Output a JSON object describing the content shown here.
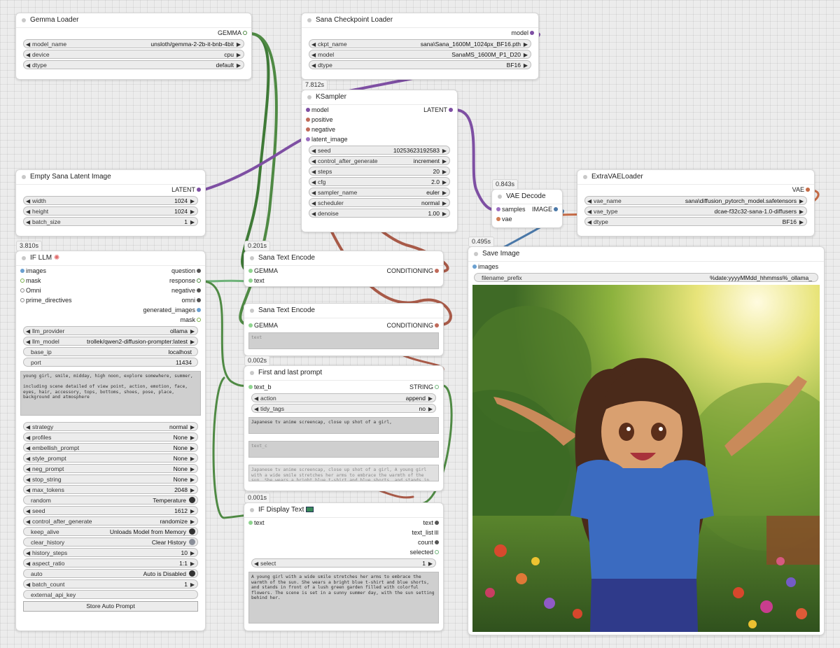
{
  "colors": {
    "background": "#ececec",
    "model_purple": "#7e4fa3",
    "gemma_green": "#4f8a44",
    "conditioning_red": "#a85a48",
    "vae_orange": "#c56a45",
    "image_blue": "#4a78a8",
    "string_green": "#6fb37a"
  },
  "icons": {
    "llm_title": "sparkle-icon",
    "display_text_title": "monitor-icon"
  },
  "gemma_loader": {
    "title": "Gemma Loader",
    "out_gemma": "GEMMA",
    "widgets": [
      {
        "name": "model_name",
        "value": "unsloth/gemma-2-2b-it-bnb-4bit"
      },
      {
        "name": "device",
        "value": "cpu"
      },
      {
        "name": "dtype",
        "value": "default"
      }
    ]
  },
  "sana_checkpoint": {
    "title": "Sana Checkpoint Loader",
    "out_model": "model",
    "widgets": [
      {
        "name": "ckpt_name",
        "value": "sana\\Sana_1600M_1024px_BF16.pth"
      },
      {
        "name": "model",
        "value": "SanaMS_1600M_P1_D20"
      },
      {
        "name": "dtype",
        "value": "BF16"
      }
    ]
  },
  "ksampler": {
    "time": "7.812s",
    "title": "KSampler",
    "inputs": [
      "model",
      "positive",
      "negative",
      "latent_image"
    ],
    "out_latent": "LATENT",
    "widgets": [
      {
        "name": "seed",
        "value": "10253623192583"
      },
      {
        "name": "control_after_generate",
        "value": "increment"
      },
      {
        "name": "steps",
        "value": "20"
      },
      {
        "name": "cfg",
        "value": "2.0"
      },
      {
        "name": "sampler_name",
        "value": "euler"
      },
      {
        "name": "scheduler",
        "value": "normal"
      },
      {
        "name": "denoise",
        "value": "1.00"
      }
    ]
  },
  "empty_latent": {
    "title": "Empty Sana Latent Image",
    "out_latent": "LATENT",
    "widgets": [
      {
        "name": "width",
        "value": "1024"
      },
      {
        "name": "height",
        "value": "1024"
      },
      {
        "name": "batch_size",
        "value": "1"
      }
    ]
  },
  "vae_decode": {
    "time": "0.843s",
    "title": "VAE Decode",
    "in_samples": "samples",
    "in_vae": "vae",
    "out_image": "IMAGE"
  },
  "extra_vae": {
    "title": "ExtraVAELoader",
    "out_vae": "VAE",
    "widgets": [
      {
        "name": "vae_name",
        "value": "sana\\diffusion_pytorch_model.safetensors"
      },
      {
        "name": "vae_type",
        "value": "dcae-f32c32-sana-1.0-diffusers"
      },
      {
        "name": "dtype",
        "value": "BF16"
      }
    ]
  },
  "if_llm": {
    "time": "3.810s",
    "title": "IF LLM",
    "inputs": [
      "images",
      "mask",
      "Omni",
      "prime_directives"
    ],
    "outputs": [
      "question",
      "response",
      "negative",
      "omni",
      "generated_images",
      "mask"
    ],
    "widgets_a": [
      {
        "name": "llm_provider",
        "value": "ollama"
      },
      {
        "name": "llm_model",
        "value": "trollek/qwen2-diffusion-prompter:latest"
      }
    ],
    "fields": [
      {
        "name": "base_ip",
        "value": "localhost"
      },
      {
        "name": "port",
        "value": "11434"
      }
    ],
    "prompt_text": "young girl, smile, midday, high noon, explore somewhere, summer,\n\nincluding scene detailed of view point, action, emotion, face, eyes, hair, accessory, tops, bottoms, shoes, pose, place, background and atmosphere",
    "widgets_b": [
      {
        "name": "strategy",
        "value": "normal"
      },
      {
        "name": "profiles",
        "value": "None"
      },
      {
        "name": "embellish_prompt",
        "value": "None"
      },
      {
        "name": "style_prompt",
        "value": "None"
      },
      {
        "name": "neg_prompt",
        "value": "None"
      },
      {
        "name": "stop_string",
        "value": "None"
      },
      {
        "name": "max_tokens",
        "value": "2048"
      }
    ],
    "random": {
      "name": "random",
      "value": "Temperature"
    },
    "seed": {
      "name": "seed",
      "value": "1612"
    },
    "control_after_generate": {
      "name": "control_after_generate",
      "value": "randomize"
    },
    "keep_alive": {
      "name": "keep_alive",
      "value": "Unloads Model from Memory"
    },
    "clear_history": {
      "name": "clear_history",
      "value": "Clear History"
    },
    "history_steps": {
      "name": "history_steps",
      "value": "10"
    },
    "aspect_ratio": {
      "name": "aspect_ratio",
      "value": "1:1"
    },
    "auto": {
      "name": "auto",
      "value": "Auto is Disabled"
    },
    "batch_count": {
      "name": "batch_count",
      "value": "1"
    },
    "external_api_key": "external_api_key",
    "button": "Store Auto Prompt"
  },
  "sana_text_1": {
    "time": "0.201s",
    "title": "Sana Text Encode",
    "in_gemma": "GEMMA",
    "in_text": "text",
    "out_cond": "CONDITIONING"
  },
  "sana_text_2": {
    "title": "Sana Text Encode",
    "in_gemma": "GEMMA",
    "out_cond": "CONDITIONING",
    "placeholder": "text"
  },
  "first_last": {
    "time": "0.002s",
    "title": "First and last prompt",
    "in_text_b": "text_b",
    "out_string": "STRING",
    "widgets": [
      {
        "name": "action",
        "value": "append"
      },
      {
        "name": "tidy_tags",
        "value": "no"
      }
    ],
    "text_a": "Japanese tv anime screencap, close up shot of a girl,",
    "text_c_placeholder": "text_c",
    "result": "Japanese tv anime screencap, close up shot of a girl, A young girl with a wide smile stretches her arms to embrace the warmth of the sun. She wears a bright blue t-shirt and blue shorts, and stands in front of a lush green"
  },
  "display_text": {
    "time": "0.001s",
    "title": "IF Display Text",
    "in_text": "text",
    "outputs": [
      "text",
      "text_list",
      "count",
      "selected"
    ],
    "select": {
      "name": "select",
      "value": "1"
    },
    "content": "A young girl with a wide smile stretches her arms to embrace the warmth of the sun. She wears a bright blue t-shirt and blue shorts, and stands in front of a lush green garden filled with colorful flowers. The scene is set in a sunny summer day, with the sun setting behind her."
  },
  "save_image": {
    "time": "0.495s",
    "title": "Save Image",
    "in_images": "images",
    "filename_prefix": {
      "name": "filename_prefix",
      "value": "%date:yyyyMMdd_hhmmss%_ollama_"
    }
  }
}
